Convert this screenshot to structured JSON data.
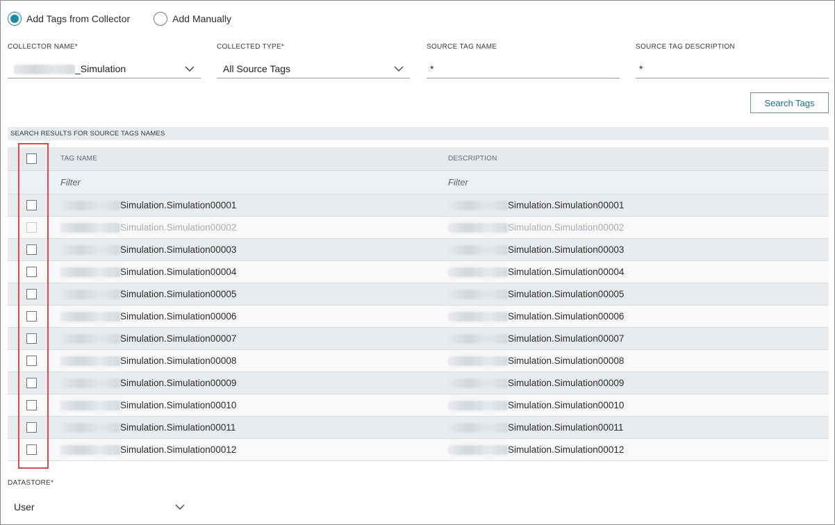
{
  "mode": {
    "options": [
      {
        "label": "Add Tags from Collector",
        "selected": true
      },
      {
        "label": "Add Manually",
        "selected": false
      }
    ]
  },
  "filters": {
    "collector_name": {
      "label": "COLLECTOR NAME*",
      "value": "_Simulation"
    },
    "collected_type": {
      "label": "COLLECTED TYPE*",
      "value": "All Source Tags"
    },
    "source_tag_name": {
      "label": "SOURCE TAG NAME",
      "value": "*"
    },
    "source_tag_description": {
      "label": "SOURCE TAG DESCRIPTION",
      "value": "*"
    }
  },
  "search_button": "Search Tags",
  "results": {
    "title": "SEARCH RESULTS FOR SOURCE TAGS NAMES",
    "columns": {
      "tag_name": "TAG NAME",
      "description": "DESCRIPTION"
    },
    "filter_placeholders": {
      "tag_name": "Filter",
      "description": "Filter"
    },
    "rows": [
      {
        "name": "Simulation.Simulation00001",
        "description": "Simulation.Simulation00001",
        "disabled": false
      },
      {
        "name": "Simulation.Simulation00002",
        "description": "Simulation.Simulation00002",
        "disabled": true
      },
      {
        "name": "Simulation.Simulation00003",
        "description": "Simulation.Simulation00003",
        "disabled": false
      },
      {
        "name": "Simulation.Simulation00004",
        "description": "Simulation.Simulation00004",
        "disabled": false
      },
      {
        "name": "Simulation.Simulation00005",
        "description": "Simulation.Simulation00005",
        "disabled": false
      },
      {
        "name": "Simulation.Simulation00006",
        "description": "Simulation.Simulation00006",
        "disabled": false
      },
      {
        "name": "Simulation.Simulation00007",
        "description": "Simulation.Simulation00007",
        "disabled": false
      },
      {
        "name": "Simulation.Simulation00008",
        "description": "Simulation.Simulation00008",
        "disabled": false
      },
      {
        "name": "Simulation.Simulation00009",
        "description": "Simulation.Simulation00009",
        "disabled": false
      },
      {
        "name": "Simulation.Simulation00010",
        "description": "Simulation.Simulation00010",
        "disabled": false
      },
      {
        "name": "Simulation.Simulation00011",
        "description": "Simulation.Simulation00011",
        "disabled": false
      },
      {
        "name": "Simulation.Simulation00012",
        "description": "Simulation.Simulation00012",
        "disabled": false
      }
    ]
  },
  "datastore": {
    "label": "DATASTORE*",
    "value": "User"
  },
  "colors": {
    "accent": "#1b8ca6",
    "highlight": "#e0474c",
    "button_text": "#1a6a8f"
  },
  "icons": {
    "dropdown": "chevron-down-icon",
    "checkbox": "checkbox-unchecked"
  }
}
